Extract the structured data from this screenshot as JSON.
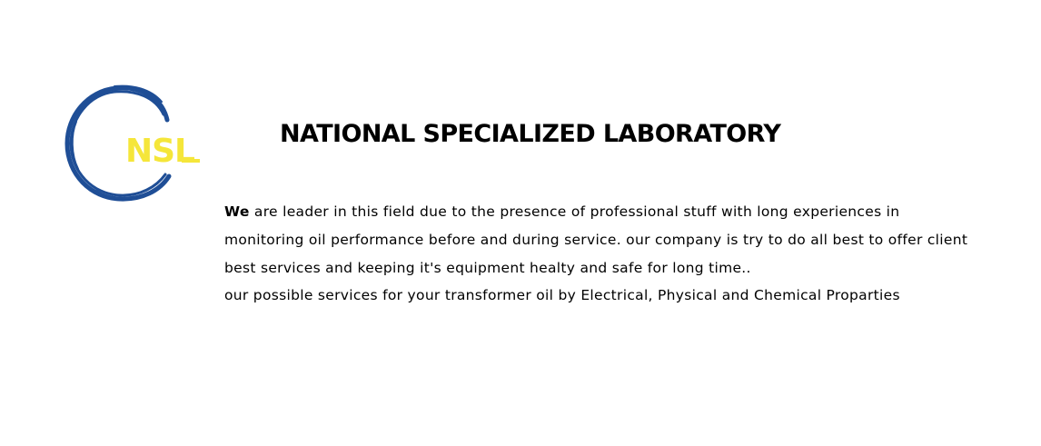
{
  "logo": {
    "text": "NSL",
    "ring_color": "#1f4e96",
    "text_color": "#f5e63a"
  },
  "header": {
    "title": "NATIONAL SPECIALIZED LABORATORY"
  },
  "description": {
    "lead_word": "We",
    "line1_rest": " are leader in this field due to the presence of professional stuff with long experiences in",
    "line2": "monitoring oil performance before and during service. our company is try to do all best to offer client",
    "line3": "best services and keeping it's equipment healty and safe for long time..",
    "line4": "our possible services for your transformer oil by Electrical, Physical and Chemical Proparties"
  }
}
